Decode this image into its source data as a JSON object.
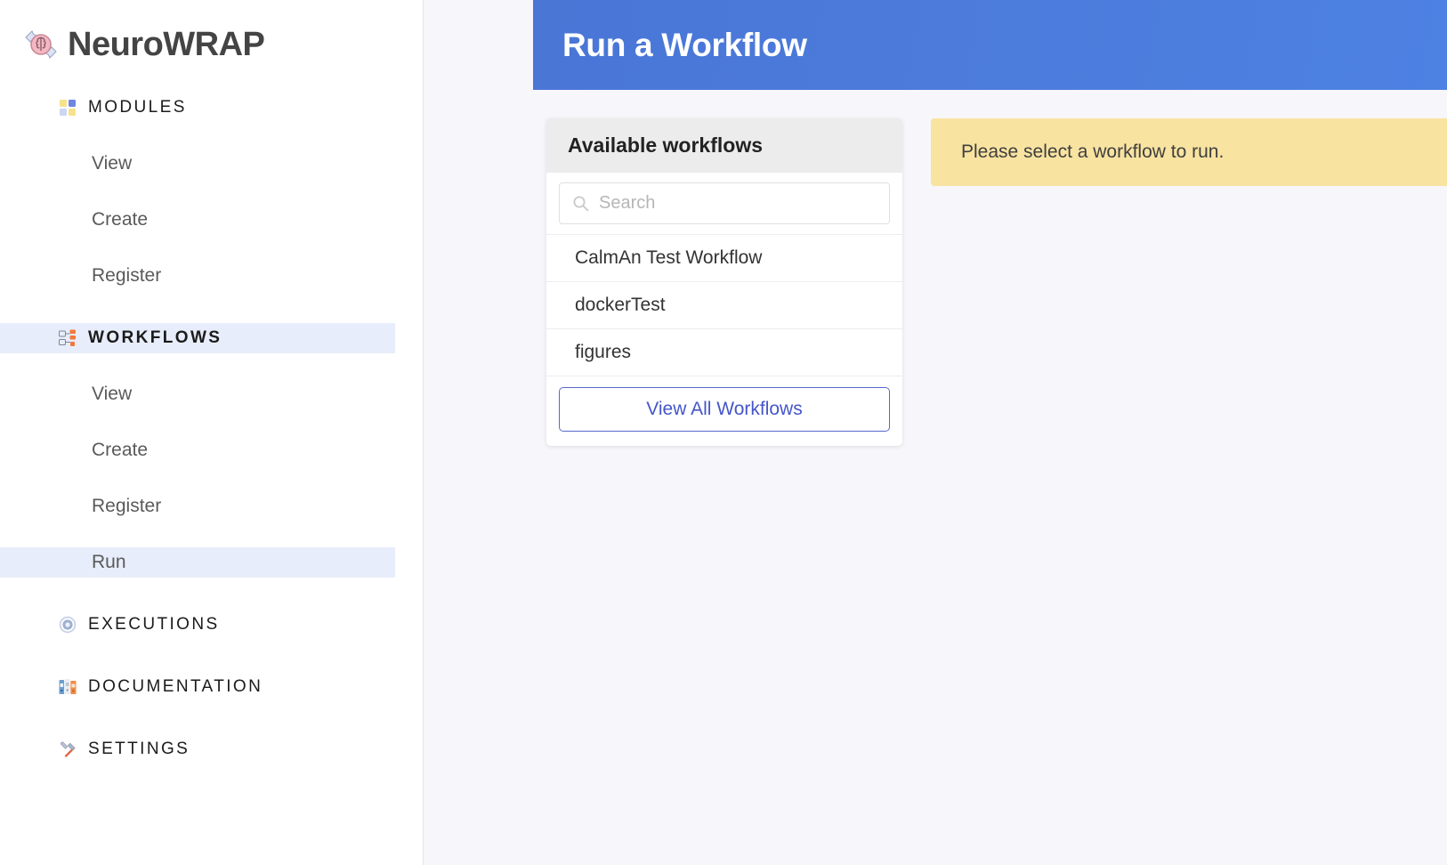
{
  "brand": {
    "name": "NeuroWRAP",
    "logo_icon": "brain-refresh-icon"
  },
  "sidebar": {
    "sections": [
      {
        "key": "modules",
        "label": "MODULES",
        "icon": "grid-squares-icon",
        "active": false,
        "items": [
          {
            "label": "View",
            "active": false
          },
          {
            "label": "Create",
            "active": false
          },
          {
            "label": "Register",
            "active": false
          }
        ]
      },
      {
        "key": "workflows",
        "label": "WORKFLOWS",
        "icon": "flowchart-icon",
        "active": true,
        "items": [
          {
            "label": "View",
            "active": false
          },
          {
            "label": "Create",
            "active": false
          },
          {
            "label": "Register",
            "active": false
          },
          {
            "label": "Run",
            "active": true
          }
        ]
      },
      {
        "key": "executions",
        "label": "EXECUTIONS",
        "icon": "gear-icon",
        "active": false,
        "items": []
      },
      {
        "key": "documentation",
        "label": "DOCUMENTATION",
        "icon": "books-icon",
        "active": false,
        "items": []
      },
      {
        "key": "settings",
        "label": "SETTINGS",
        "icon": "tools-icon",
        "active": false,
        "items": []
      }
    ]
  },
  "header": {
    "title": "Run a Workflow",
    "background_color": "#4a76d6",
    "text_color": "#ffffff"
  },
  "workflow_card": {
    "title": "Available workflows",
    "search": {
      "icon": "search-icon",
      "value": "",
      "placeholder": "Search"
    },
    "workflows": [
      "CalmAn Test Workflow",
      "dockerTest",
      "figures"
    ],
    "view_all_label": "View All Workflows",
    "view_all_color": "#4556c9"
  },
  "alert": {
    "message": "Please select a workflow to run.",
    "background_color": "#f8e3a1",
    "text_color": "#3f3f3f"
  },
  "colors": {
    "accent": "#4a76d6",
    "sidebar_active": "#e8edfb",
    "page_background": "#f7f6fa",
    "card_header": "#ececec"
  }
}
